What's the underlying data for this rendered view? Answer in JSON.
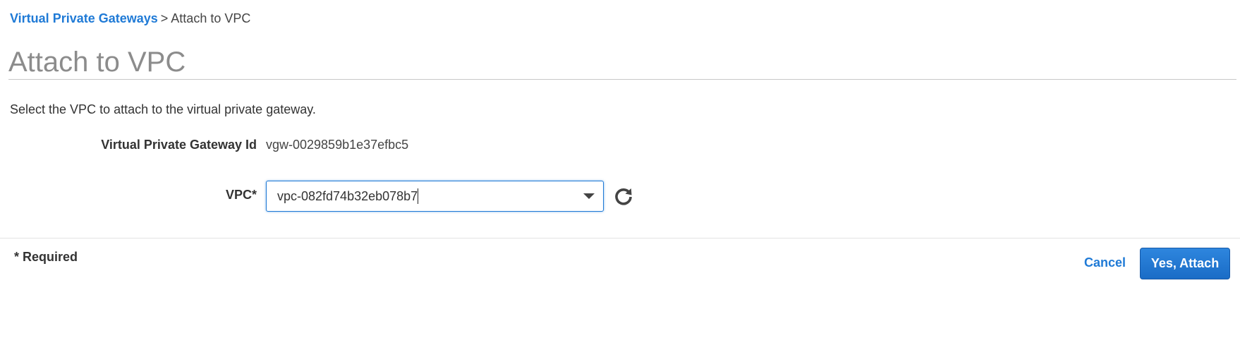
{
  "breadcrumb": {
    "parent_link": "Virtual Private Gateways",
    "separator": ">",
    "current": "Attach to VPC"
  },
  "page_title": "Attach to VPC",
  "description": "Select the VPC to attach to the virtual private gateway.",
  "fields": {
    "gateway_id": {
      "label": "Virtual Private Gateway Id",
      "value": "vgw-0029859b1e37efbc5"
    },
    "vpc": {
      "label": "VPC*",
      "selected_value": "vpc-082fd74b32eb078b7",
      "dropdown_icon": "chevron-down-icon",
      "refresh_icon": "refresh-icon"
    }
  },
  "footer": {
    "required_note": "* Required",
    "cancel_label": "Cancel",
    "submit_label": "Yes, Attach"
  },
  "colors": {
    "link": "#1f7ad6",
    "primary_button": "#1a6cc6",
    "title": "#8c8c8c"
  }
}
